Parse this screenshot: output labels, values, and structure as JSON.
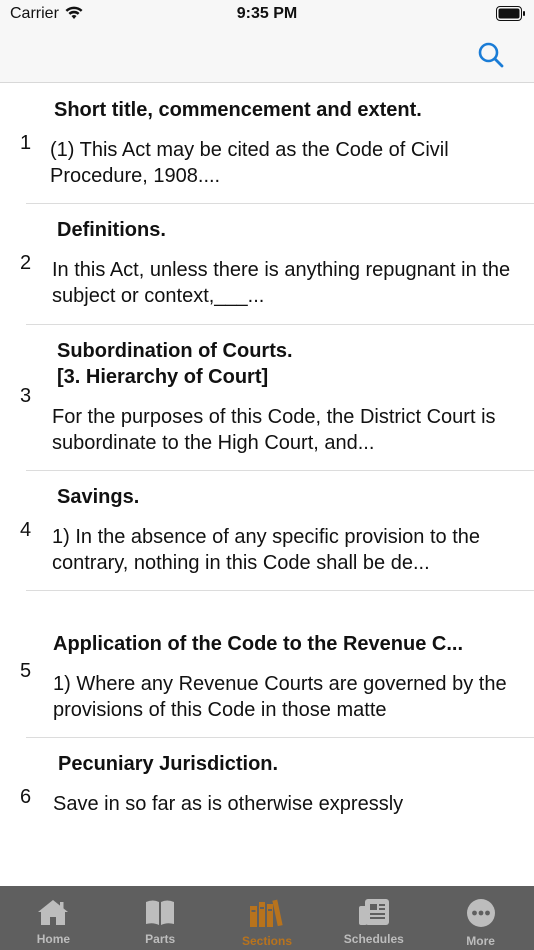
{
  "status": {
    "carrier": "Carrier",
    "time": "9:35 PM"
  },
  "nav": {
    "search_icon": "search-icon"
  },
  "sections": [
    {
      "num": "1",
      "title": "Short title, commencement and extent.",
      "body": "(1) This Act may be cited as the Code of Civil Procedure, 1908...."
    },
    {
      "num": "2",
      "title": "Definitions.",
      "body": "In this Act, unless there is anything repugnant in the subject or context,___..."
    },
    {
      "num": "3",
      "title": "Subordination of Courts.\n[3. Hierarchy of Court]",
      "body": "For the purposes of this Code, the District Court is subordinate to the High Court, and..."
    },
    {
      "num": "4",
      "title": "Savings.",
      "body": "1) In the absence of any specific provision to the contrary, nothing in this Code shall be de..."
    },
    {
      "num": "5",
      "title": "Application of the Code to the Revenue C...",
      "body": "1) Where any Revenue Courts are governed by the provisions of this Code in those matte"
    },
    {
      "num": "6",
      "title": "Pecuniary Jurisdiction.",
      "body": "Save in so far as is otherwise expressly"
    }
  ],
  "tabs": [
    {
      "label": "Home",
      "icon": "house-icon"
    },
    {
      "label": "Parts",
      "icon": "book-icon"
    },
    {
      "label": "Sections",
      "icon": "books-icon"
    },
    {
      "label": "Schedules",
      "icon": "newspaper-icon"
    },
    {
      "label": "More",
      "icon": "ellipsis-circle-icon"
    }
  ],
  "active_tab": "Sections",
  "colors": {
    "accent": "#1a7cd6",
    "tab_active": "#b8731d",
    "tab_inactive": "#bdbdbd",
    "tab_bar": "#5f5f5f"
  }
}
